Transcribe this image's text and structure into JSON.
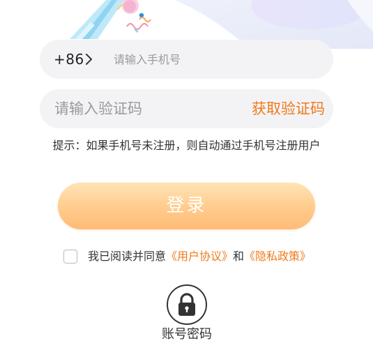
{
  "phone": {
    "country_code": "+86",
    "placeholder": "请输入手机号"
  },
  "code": {
    "placeholder": "请输入验证码",
    "get_code_label": "获取验证码"
  },
  "hint": "提示：如果手机号未注册，则自动通过手机号注册用户",
  "login_button": "登录",
  "agreement": {
    "prefix": "我已阅读并同意",
    "user_agreement": "《用户协议》",
    "and": "和",
    "privacy_policy": "《隐私政策》"
  },
  "alt_login": {
    "label": "账号密码",
    "icon": "lock-icon"
  },
  "colors": {
    "accent": "#f07a1a",
    "button_gradient_top": "#ffe4b4",
    "button_gradient_bottom": "#ffbb78",
    "field_bg": "#f3f3f5"
  }
}
